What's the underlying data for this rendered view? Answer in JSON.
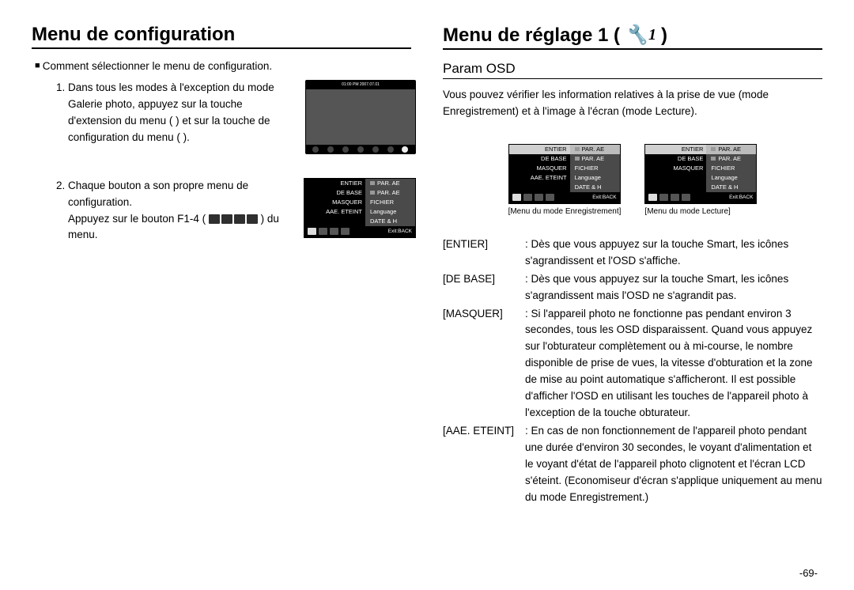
{
  "page_number": "-69-",
  "left": {
    "heading": "Menu de configuration",
    "intro": "Comment sélectionner le menu de configuration.",
    "step1": "Dans tous les modes à l'exception du mode Galerie photo, appuyez sur la touche d'extension du menu (        ) et sur la touche de configuration du menu (        ).",
    "step2_a": "Chaque bouton a son propre menu de configuration.",
    "step2_b": "Appuyez sur le bouton F1-4 (",
    "step2_c": ") du menu.",
    "thumb_time": "01:00 PM 2007.07.01"
  },
  "right": {
    "heading_prefix": "Menu de réglage 1 (",
    "heading_icon_sub": "1",
    "heading_suffix": ")",
    "subheading": "Param OSD",
    "desc": "Vous pouvez vérifier les information relatives à la prise de vue (mode Enregistrement) et à l'image à l'écran (mode Lecture).",
    "caption_left": "[Menu du mode Enregistrement]",
    "caption_right": "[Menu du mode Lecture]",
    "defs": [
      {
        "term": "[ENTIER]",
        "def": "Dès que vous appuyez sur la touche Smart, les icônes s'agrandissent et l'OSD s'affiche."
      },
      {
        "term": "[DE BASE]",
        "def": "Dès que vous appuyez sur la touche Smart, les icônes s'agrandissent mais l'OSD ne s'agrandit pas."
      },
      {
        "term": "[MASQUER]",
        "def": "Si l'appareil photo ne fonctionne pas pendant environ 3 secondes, tous les OSD disparaissent. Quand vous appuyez sur l'obturateur complètement ou à mi-course, le nombre disponible de prise de vues, la vitesse d'obturation et la zone de mise au point automatique s'afficheront. Il est possible d'afficher l'OSD en utilisant les touches de l'appareil photo à l'exception de la touche obturateur."
      },
      {
        "term": "[AAE. ETEINT]",
        "def": "En cas de non fonctionnement de l'appareil photo pendant une durée d'environ 30 secondes, le voyant d'alimentation et le voyant d'état de l'appareil photo clignotent et l'écran LCD s'éteint. (Economiseur d'écran s'applique uniquement au menu du mode Enregistrement.)"
      }
    ]
  },
  "menu_full": {
    "rows": [
      {
        "l": "ENTIER",
        "r": "PAR. AE"
      },
      {
        "l": "DE BASE",
        "r": "PAR. AE"
      },
      {
        "l": "MASQUER",
        "r": "FICHIER"
      },
      {
        "l": "AAE. ETEINT",
        "r": "Language"
      },
      {
        "l": "",
        "r": "DATE & H"
      }
    ],
    "exit": "Exit:BACK"
  },
  "menu_short": {
    "rows": [
      {
        "l": "ENTIER",
        "r": "PAR. AE"
      },
      {
        "l": "DE BASE",
        "r": "PAR. AE"
      },
      {
        "l": "MASQUER",
        "r": "FICHIER"
      },
      {
        "l": "",
        "r": "Language"
      },
      {
        "l": "",
        "r": "DATE & H"
      }
    ],
    "exit": "Exit:BACK"
  }
}
